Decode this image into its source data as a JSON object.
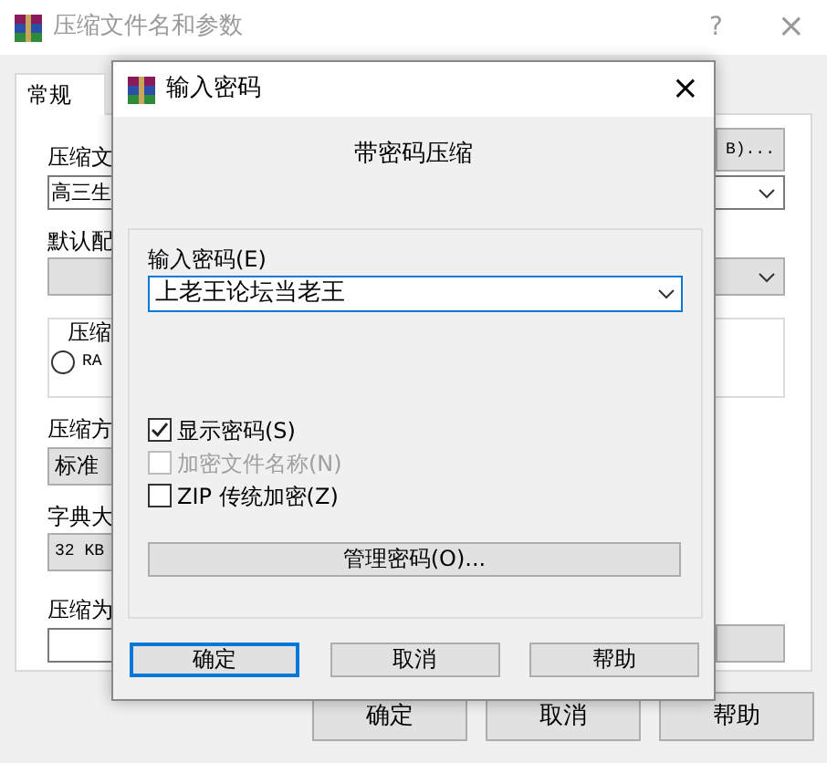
{
  "window": {
    "title": "压缩文件名和参数",
    "help": "?",
    "close": "×"
  },
  "tabs": [
    {
      "label": "常规",
      "selected": true
    }
  ],
  "general": {
    "archive_label": "压缩文",
    "archive_name": "高三生",
    "browse_button": "B)...",
    "profile_label": "默认配",
    "format_group": "压缩",
    "format_options": [
      {
        "label": "RA",
        "selected": false
      }
    ],
    "method_label": "压缩方",
    "method_value": "标准",
    "dict_label": "字典大",
    "dict_value": "32 KB",
    "split_label": "压缩为"
  },
  "buttons": [
    {
      "label": "确定"
    },
    {
      "label": "取消"
    },
    {
      "label": "帮助"
    }
  ],
  "dialog": {
    "title": "输入密码",
    "close": "×",
    "heading": "带密码压缩",
    "password_label": "输入密码(E)",
    "password_value": "上老王论坛当老王",
    "options": [
      {
        "label": "显示密码(S)",
        "checked": true,
        "disabled": false
      },
      {
        "label": "加密文件名称(N)",
        "checked": false,
        "disabled": true
      },
      {
        "label": "ZIP 传统加密(Z)",
        "checked": false,
        "disabled": false
      }
    ],
    "manage_button": "管理密码(O)...",
    "buttons": [
      {
        "label": "确定",
        "default": true
      },
      {
        "label": "取消",
        "default": false
      },
      {
        "label": "帮助",
        "default": false
      }
    ]
  }
}
